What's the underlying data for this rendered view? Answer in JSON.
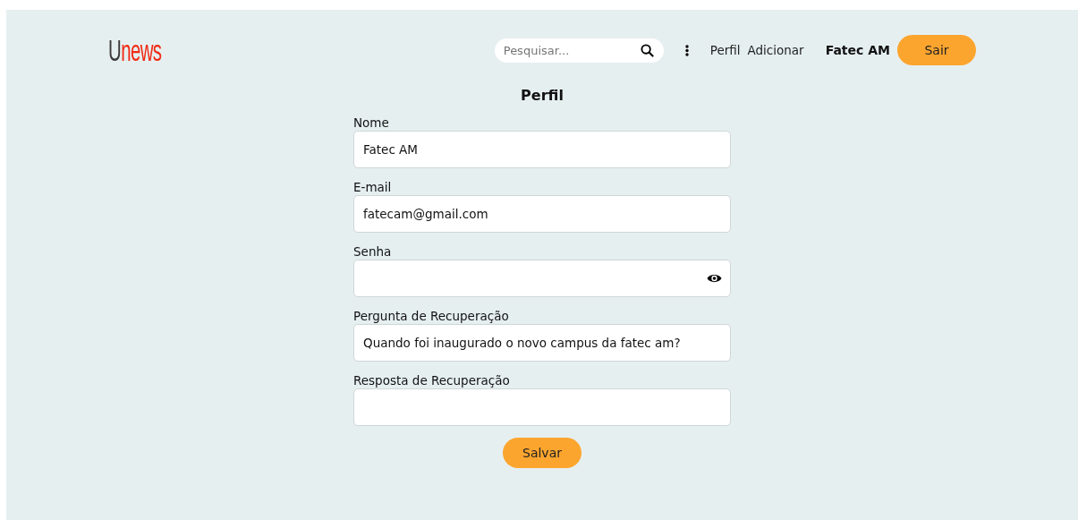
{
  "logo": "Unews",
  "search": {
    "placeholder": "Pesquisar..."
  },
  "nav_links": [
    "Perfil",
    "Adicionar"
  ],
  "user_name": "Fatec AM",
  "logout_button": "Sair",
  "form": {
    "title": "Perfil",
    "fields": [
      {
        "label": "Nome",
        "kind": "text",
        "value": "Fatec AM"
      },
      {
        "label": "E-mail",
        "kind": "text",
        "value": "fatecam@gmail.com"
      },
      {
        "label": "Senha",
        "kind": "password"
      },
      {
        "label": "Pergunta de Recuperação",
        "kind": "text",
        "value": "Quando foi inaugurado o novo campus da fatec am?"
      },
      {
        "label": "Resposta de Recuperação",
        "kind": "text"
      }
    ],
    "submit": "Salvar"
  }
}
